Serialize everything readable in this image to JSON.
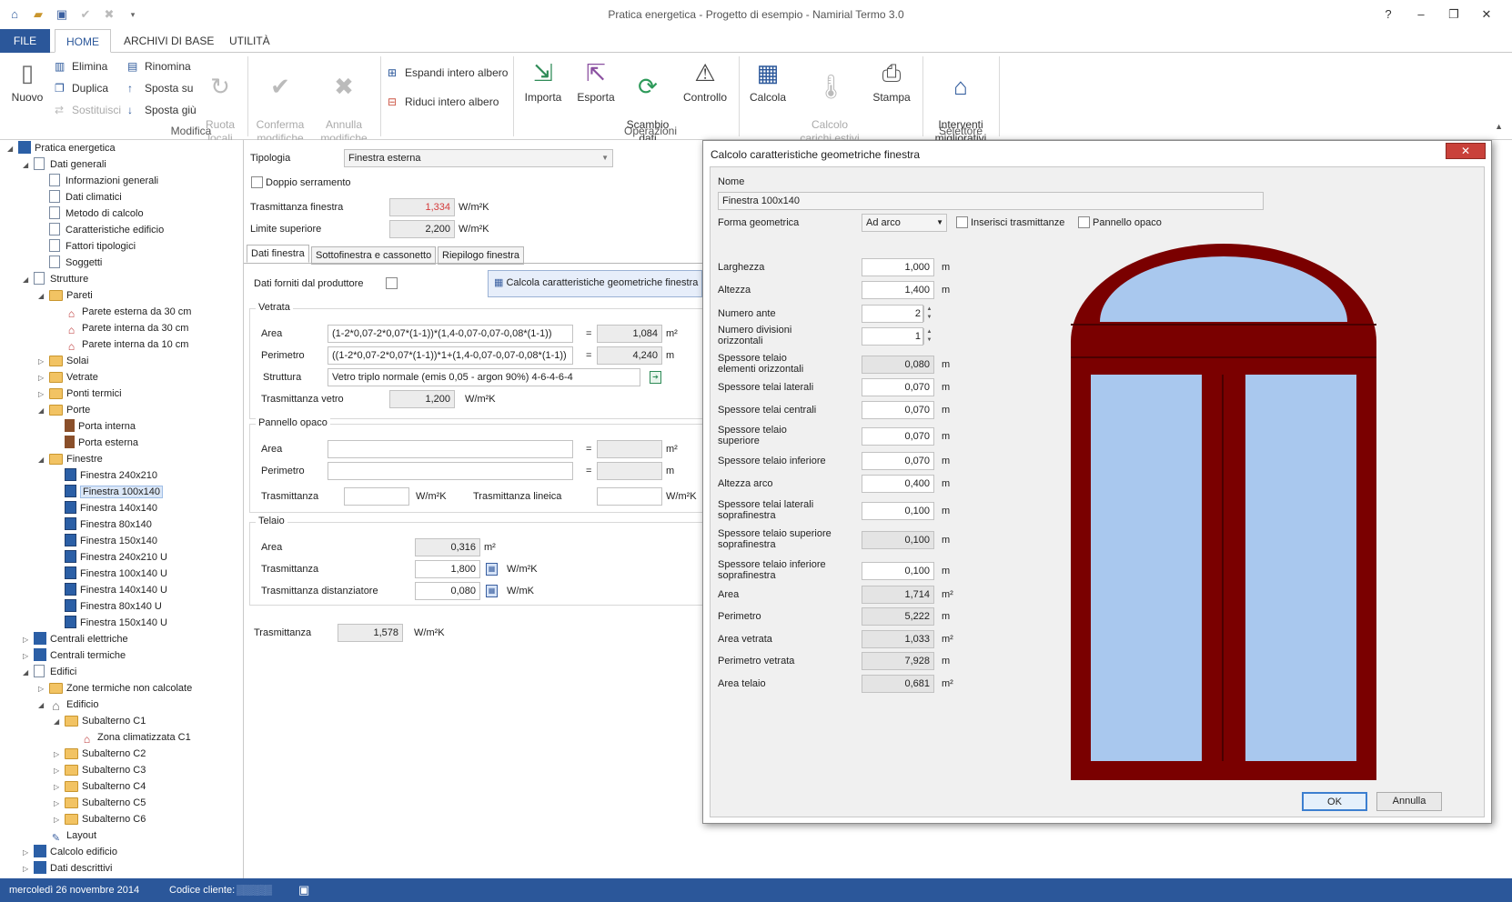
{
  "app": {
    "title": "Pratica energetica - Progetto di esempio - Namirial Termo 3.0"
  },
  "window_controls": {
    "help": "?",
    "minimize": "–",
    "restore": "❐",
    "close": "✕"
  },
  "menu_tabs": [
    "FILE",
    "HOME",
    "ARCHIVI DI BASE",
    "UTILITÀ"
  ],
  "ribbon": {
    "nuovo": "Nuovo",
    "elimina": "Elimina",
    "rinomina": "Rinomina",
    "duplica": "Duplica",
    "sposta_su": "Sposta su",
    "sostituisci": "Sostituisci",
    "sposta_giu": "Sposta giù",
    "ruota_locali": "Ruota\nlocali",
    "group_modifica": "Modifica",
    "conferma": "Conferma\nmodifiche",
    "annulla": "Annulla\nmodifiche",
    "espandi": "Espandi intero albero",
    "riduci": "Riduci intero albero",
    "importa": "Importa",
    "esporta": "Esporta",
    "scambio": "Scambio\ndati",
    "controllo": "Controllo",
    "group_operazioni": "Operazioni",
    "calcola": "Calcola",
    "calcolo_carichi": "Calcolo\ncarichi estivi",
    "stampa": "Stampa",
    "interventi": "Interventi\nmigliorativi",
    "group_selettore": "Selettore"
  },
  "tree": [
    {
      "label": "Pratica energetica",
      "level": 0,
      "exp": "◢",
      "icon": "struct"
    },
    {
      "label": "Dati generali",
      "level": 1,
      "exp": "◢",
      "icon": "doc"
    },
    {
      "label": "Informazioni generali",
      "level": 2,
      "exp": "",
      "icon": "doc"
    },
    {
      "label": "Dati climatici",
      "level": 2,
      "exp": "",
      "icon": "doc"
    },
    {
      "label": "Metodo di calcolo",
      "level": 2,
      "exp": "",
      "icon": "doc"
    },
    {
      "label": "Caratteristiche edificio",
      "level": 2,
      "exp": "",
      "icon": "doc"
    },
    {
      "label": "Fattori tipologici",
      "level": 2,
      "exp": "",
      "icon": "doc"
    },
    {
      "label": "Soggetti",
      "level": 2,
      "exp": "",
      "icon": "doc"
    },
    {
      "label": "Strutture",
      "level": 1,
      "exp": "◢",
      "icon": "doc"
    },
    {
      "label": "Pareti",
      "level": 2,
      "exp": "◢",
      "icon": "folder"
    },
    {
      "label": "Parete esterna da 30 cm",
      "level": 3,
      "exp": "",
      "icon": "wall"
    },
    {
      "label": "Parete interna da 30 cm",
      "level": 3,
      "exp": "",
      "icon": "wall"
    },
    {
      "label": "Parete interna da 10 cm",
      "level": 3,
      "exp": "",
      "icon": "wall"
    },
    {
      "label": "Solai",
      "level": 2,
      "exp": "▷",
      "icon": "folder"
    },
    {
      "label": "Vetrate",
      "level": 2,
      "exp": "▷",
      "icon": "folder"
    },
    {
      "label": "Ponti termici",
      "level": 2,
      "exp": "▷",
      "icon": "folder"
    },
    {
      "label": "Porte",
      "level": 2,
      "exp": "◢",
      "icon": "folder"
    },
    {
      "label": "Porta interna",
      "level": 3,
      "exp": "",
      "icon": "door"
    },
    {
      "label": "Porta esterna",
      "level": 3,
      "exp": "",
      "icon": "door"
    },
    {
      "label": "Finestre",
      "level": 2,
      "exp": "◢",
      "icon": "folder"
    },
    {
      "label": "Finestra 240x210",
      "level": 3,
      "exp": "",
      "icon": "win"
    },
    {
      "label": "Finestra 100x140",
      "level": 3,
      "exp": "",
      "icon": "win",
      "selected": true
    },
    {
      "label": "Finestra 140x140",
      "level": 3,
      "exp": "",
      "icon": "win"
    },
    {
      "label": "Finestra 80x140",
      "level": 3,
      "exp": "",
      "icon": "win"
    },
    {
      "label": "Finestra 150x140",
      "level": 3,
      "exp": "",
      "icon": "win"
    },
    {
      "label": "Finestra 240x210 U",
      "level": 3,
      "exp": "",
      "icon": "win"
    },
    {
      "label": "Finestra 100x140 U",
      "level": 3,
      "exp": "",
      "icon": "win"
    },
    {
      "label": "Finestra 140x140 U",
      "level": 3,
      "exp": "",
      "icon": "win"
    },
    {
      "label": "Finestra 80x140 U",
      "level": 3,
      "exp": "",
      "icon": "win"
    },
    {
      "label": "Finestra 150x140 U",
      "level": 3,
      "exp": "",
      "icon": "win"
    },
    {
      "label": "Centrali elettriche",
      "level": 1,
      "exp": "▷",
      "icon": "struct"
    },
    {
      "label": "Centrali termiche",
      "level": 1,
      "exp": "▷",
      "icon": "struct"
    },
    {
      "label": "Edifici",
      "level": 1,
      "exp": "◢",
      "icon": "doc"
    },
    {
      "label": "Zone termiche non calcolate",
      "level": 2,
      "exp": "▷",
      "icon": "folder"
    },
    {
      "label": "Edificio",
      "level": 2,
      "exp": "◢",
      "icon": "house"
    },
    {
      "label": "Subalterno C1",
      "level": 3,
      "exp": "◢",
      "icon": "folder"
    },
    {
      "label": "Zona climatizzata C1",
      "level": 4,
      "exp": "",
      "icon": "wall"
    },
    {
      "label": "Subalterno C2",
      "level": 3,
      "exp": "▷",
      "icon": "folder"
    },
    {
      "label": "Subalterno C3",
      "level": 3,
      "exp": "▷",
      "icon": "folder"
    },
    {
      "label": "Subalterno C4",
      "level": 3,
      "exp": "▷",
      "icon": "folder"
    },
    {
      "label": "Subalterno C5",
      "level": 3,
      "exp": "▷",
      "icon": "folder"
    },
    {
      "label": "Subalterno C6",
      "level": 3,
      "exp": "▷",
      "icon": "folder"
    },
    {
      "label": "Layout",
      "level": 2,
      "exp": "",
      "icon": "pen"
    },
    {
      "label": "Calcolo edificio",
      "level": 1,
      "exp": "▷",
      "icon": "struct"
    },
    {
      "label": "Dati descrittivi",
      "level": 1,
      "exp": "▷",
      "icon": "struct"
    }
  ],
  "form": {
    "tipologia_label": "Tipologia",
    "tipologia_value": "Finestra esterna",
    "doppio_label": "Doppio serramento",
    "trasm_fin_label": "Trasmittanza finestra",
    "trasm_fin_value": "1,334",
    "trasm_fin_unit": "W/m²K",
    "limite_label": "Limite superiore",
    "limite_value": "2,200",
    "limite_unit": "W/m²K",
    "subtabs": [
      "Dati finestra",
      "Sottofinestra e cassonetto",
      "Riepilogo finestra"
    ],
    "dati_forniti_label": "Dati forniti dal produttore",
    "calcola_btn": "Calcola caratteristiche geometriche finestra",
    "vetrata_title": "Vetrata",
    "area_label": "Area",
    "area_formula": "(1-2*0,07-2*0,07*(1-1))*(1,4-0,07-0,07-0,08*(1-1))",
    "area_value": "1,084",
    "area_unit": "m²",
    "perim_label": "Perimetro",
    "perim_formula": "((1-2*0,07-2*0,07*(1-1))*1+(1,4-0,07-0,07-0,08*(1-1))",
    "perim_value": "4,240",
    "perim_unit": "m",
    "struttura_label": "Struttura",
    "struttura_value": "Vetro triplo normale (emis 0,05 - argon 90%) 4-6-4-6-4",
    "trasm_vetro_label": "Trasmittanza vetro",
    "trasm_vetro_value": "1,200",
    "trasm_vetro_unit": "W/m²K",
    "pannello_title": "Pannello opaco",
    "p_area_label": "Area",
    "p_area_unit": "m²",
    "p_perim_label": "Perimetro",
    "p_perim_unit": "m",
    "p_trasm_label": "Trasmittanza",
    "p_trasm_unit": "W/m²K",
    "p_trasm_lin_label": "Trasmittanza lineica",
    "p_trasm_lin_unit": "W/m²K",
    "telaio_title": "Telaio",
    "t_area_label": "Area",
    "t_area_value": "0,316",
    "t_area_unit": "m²",
    "t_trasm_label": "Trasmittanza",
    "t_trasm_value": "1,800",
    "t_trasm_unit": "W/m²K",
    "t_dist_label": "Trasmittanza distanziatore",
    "t_dist_value": "0,080",
    "t_dist_unit": "W/mK",
    "trasm_label": "Trasmittanza",
    "trasm_value": "1,578",
    "trasm_unit": "W/m²K",
    "equals": "="
  },
  "dialog": {
    "title": "Calcolo caratteristiche geometriche finestra",
    "close": "✕",
    "nome_label": "Nome",
    "nome_value": "Finestra 100x140",
    "forma_label": "Forma geometrica",
    "forma_value": "Ad arco",
    "inserisci_label": "Inserisci trasmittanze",
    "pannello_label": "Pannello opaco",
    "rows": [
      {
        "label": "Larghezza",
        "value": "1,000",
        "unit": "m",
        "ro": false
      },
      {
        "label": "Altezza",
        "value": "1,400",
        "unit": "m",
        "ro": false
      },
      {
        "label": "Numero ante",
        "value": "2",
        "unit": "",
        "ro": false,
        "spin": true
      },
      {
        "label": "Numero divisioni\norizzontali",
        "value": "1",
        "unit": "",
        "ro": false,
        "spin": true
      },
      {
        "label": "Spessore telaio\nelementi orizzontali",
        "value": "0,080",
        "unit": "m",
        "ro": true
      },
      {
        "label": "Spessore telai laterali",
        "value": "0,070",
        "unit": "m",
        "ro": false
      },
      {
        "label": "Spessore telai centrali",
        "value": "0,070",
        "unit": "m",
        "ro": false
      },
      {
        "label": "Spessore telaio\nsuperiore",
        "value": "0,070",
        "unit": "m",
        "ro": false
      },
      {
        "label": "Spessore telaio inferiore",
        "value": "0,070",
        "unit": "m",
        "ro": false
      },
      {
        "label": "Altezza arco",
        "value": "0,400",
        "unit": "m",
        "ro": false
      },
      {
        "label": "Spessore telai laterali\nsoprafinestra",
        "value": "0,100",
        "unit": "m",
        "ro": false
      },
      {
        "label": "Spessore telaio superiore\nsoprafinestra",
        "value": "0,100",
        "unit": "m",
        "ro": true
      },
      {
        "label": "Spessore telaio inferiore\nsoprafinestra",
        "value": "0,100",
        "unit": "m",
        "ro": false
      },
      {
        "label": "Area",
        "value": "1,714",
        "unit": "m²",
        "ro": true
      },
      {
        "label": "Perimetro",
        "value": "5,222",
        "unit": "m",
        "ro": true
      },
      {
        "label": "Area vetrata",
        "value": "1,033",
        "unit": "m²",
        "ro": true
      },
      {
        "label": "Perimetro vetrata",
        "value": "7,928",
        "unit": "m",
        "ro": true
      },
      {
        "label": "Area telaio",
        "value": "0,681",
        "unit": "m²",
        "ro": true
      }
    ],
    "ok": "OK",
    "annulla": "Annulla",
    "colors": {
      "frame": "#7a0000",
      "glass": "#a9c8ee"
    }
  },
  "status": {
    "date": "mercoledì 26 novembre 2014",
    "codice_label": "Codice cliente:",
    "codice_value": "▒▒▒▒▒"
  }
}
